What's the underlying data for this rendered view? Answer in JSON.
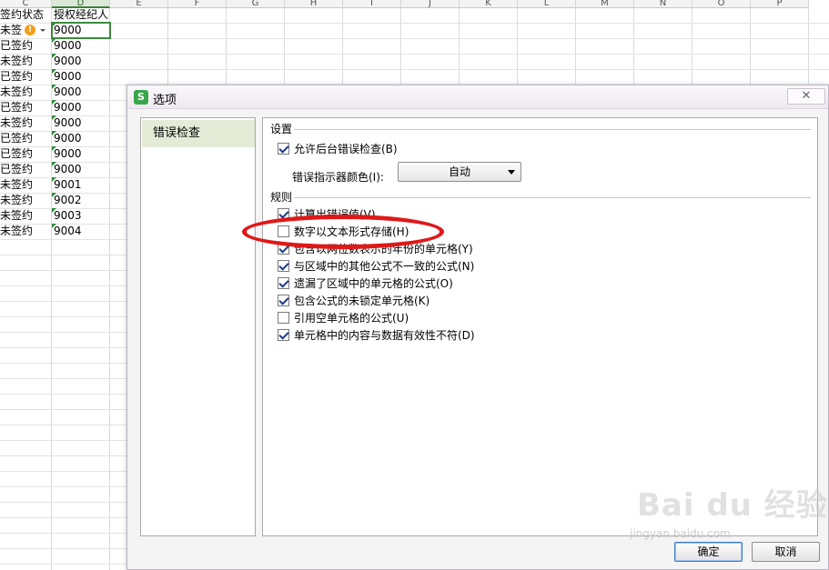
{
  "sheet": {
    "columns": [
      "C",
      "D",
      "E",
      "F",
      "G",
      "H",
      "I",
      "J",
      "K",
      "L",
      "M",
      "N",
      "O",
      "P"
    ],
    "header_row": {
      "c": "签约状态",
      "d": "授权经纪人"
    },
    "rows": [
      {
        "c": "未签",
        "d": "9000"
      },
      {
        "c": "已签约",
        "d": "9000"
      },
      {
        "c": "未签约",
        "d": "9000"
      },
      {
        "c": "已签约",
        "d": "9000"
      },
      {
        "c": "未签约",
        "d": "9000"
      },
      {
        "c": "已签约",
        "d": "9000"
      },
      {
        "c": "未签约",
        "d": "9000"
      },
      {
        "c": "已签约",
        "d": "9000"
      },
      {
        "c": "已签约",
        "d": "9000"
      },
      {
        "c": "已签约",
        "d": "9000"
      },
      {
        "c": "未签约",
        "d": "9001"
      },
      {
        "c": "未签约",
        "d": "9002"
      },
      {
        "c": "未签约",
        "d": "9003"
      },
      {
        "c": "未签约",
        "d": "9004"
      }
    ],
    "warning_icon": "exclamation-icon"
  },
  "dialog": {
    "app_icon": "S",
    "title": "选项",
    "close_glyph": "✕",
    "nav_items": [
      {
        "label": "错误检查"
      }
    ],
    "settings": {
      "heading": "设置",
      "background_check": {
        "label": "允许后台错误检查(B)",
        "checked": true
      },
      "indicator_color_label": "错误指示器颜色(I):",
      "indicator_color_value": "自动"
    },
    "rules": {
      "heading": "规则",
      "items": [
        {
          "label": "计算出错误值(V)",
          "checked": true
        },
        {
          "label": "数字以文本形式存储(H)",
          "checked": false
        },
        {
          "label": "包含以两位数表示的年份的单元格(Y)",
          "checked": true
        },
        {
          "label": "与区域中的其他公式不一致的公式(N)",
          "checked": true
        },
        {
          "label": "遗漏了区域中的单元格的公式(O)",
          "checked": true
        },
        {
          "label": "包含公式的未锁定单元格(K)",
          "checked": true
        },
        {
          "label": "引用空单元格的公式(U)",
          "checked": false
        },
        {
          "label": "单元格中的内容与数据有效性不符(D)",
          "checked": true
        }
      ]
    },
    "buttons": {
      "ok": "确定",
      "cancel": "取消"
    }
  },
  "annotation": {
    "color": "#e01818"
  },
  "watermark": {
    "logo": "Bai du 经验",
    "url": "jingyan.baidu.com"
  }
}
